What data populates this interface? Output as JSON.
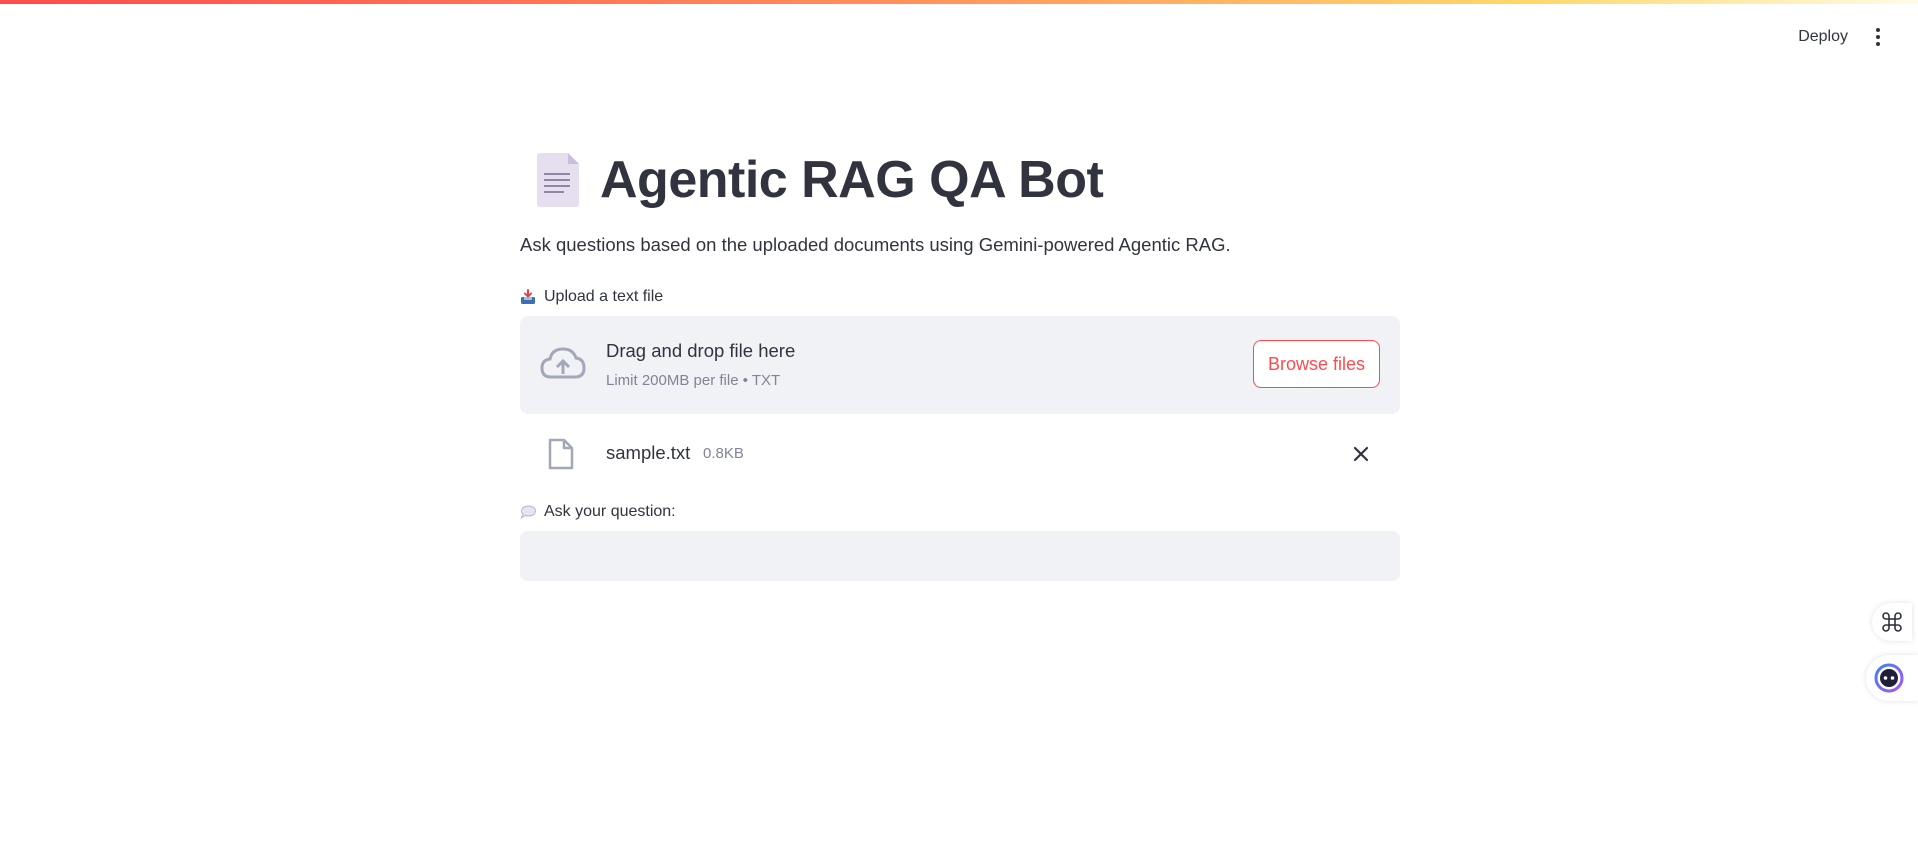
{
  "header": {
    "deploy_label": "Deploy"
  },
  "main": {
    "title": "Agentic RAG QA Bot",
    "subtitle": "Ask questions based on the uploaded documents using Gemini-powered Agentic RAG."
  },
  "uploader": {
    "label": "Upload a text file",
    "drop_text": "Drag and drop file here",
    "limit_text": "Limit 200MB per file • TXT",
    "browse_label": "Browse files",
    "file": {
      "name": "sample.txt",
      "size": "0.8KB"
    }
  },
  "question": {
    "label": "Ask your question:",
    "value": "",
    "placeholder": ""
  },
  "colors": {
    "accent": "#ff4b4b",
    "text": "#31333f",
    "muted": "#808495",
    "surface": "#f0f2f6"
  },
  "icons": {
    "title": "page-facing-up-icon",
    "upload_label": "inbox-tray-icon",
    "question_label": "speech-balloon-icon",
    "dropzone": "cloud-upload-icon",
    "file": "file-icon",
    "remove": "close-icon",
    "menu": "more-vertical-icon"
  }
}
